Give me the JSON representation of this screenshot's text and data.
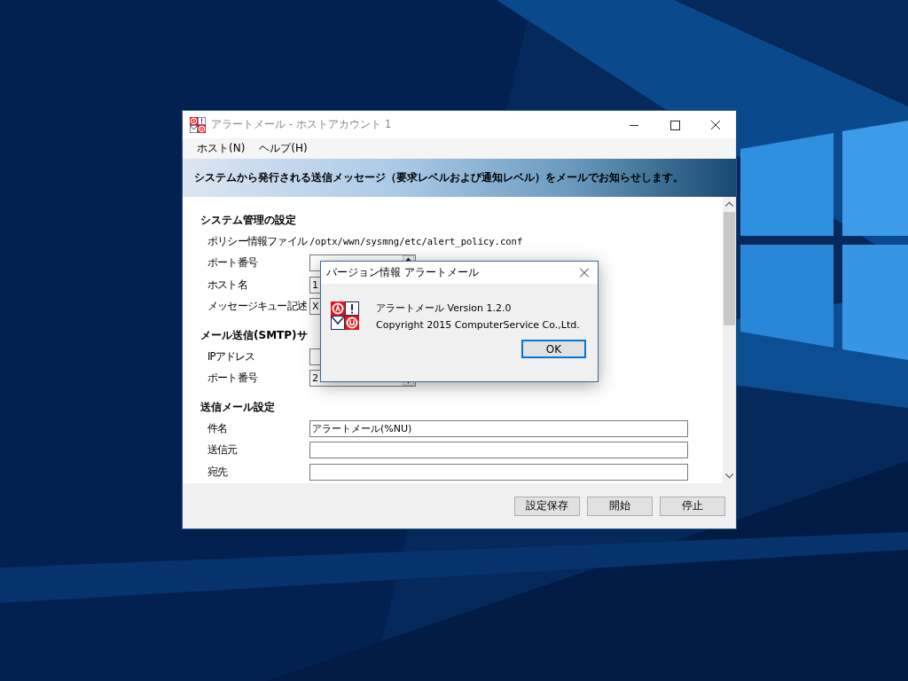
{
  "window": {
    "title": "アラートメール - ホストアカウント 1",
    "menu": [
      {
        "label": "ホスト(N)"
      },
      {
        "label": "ヘルプ(H)"
      }
    ],
    "banner": "システムから発行される送信メッセージ（要求レベルおよび通知レベル）をメールでお知らせします。",
    "sections": [
      {
        "heading": "システム管理の設定",
        "rows": [
          {
            "label": "ポリシー情報ファイル",
            "kind": "text",
            "value": "/optx/wwn/sysmng/etc/alert_policy.conf"
          },
          {
            "label": "ポート番号",
            "kind": "spin",
            "value": ""
          },
          {
            "label": "ホスト名",
            "kind": "field",
            "value": "1"
          },
          {
            "label": "メッセージキュー記述",
            "kind": "field",
            "value": "X"
          }
        ]
      },
      {
        "heading": "メール送信(SMTP)サ",
        "rows": [
          {
            "label": "IPアドレス",
            "kind": "field",
            "value": ""
          },
          {
            "label": "ポート番号",
            "kind": "spin",
            "value": "2"
          }
        ]
      },
      {
        "heading": "送信メール設定",
        "rows": [
          {
            "label": "件名",
            "kind": "wide",
            "value": "アラートメール(%NU)"
          },
          {
            "label": "送信元",
            "kind": "wide",
            "value": ""
          },
          {
            "label": "宛先",
            "kind": "wide",
            "value": ""
          }
        ]
      }
    ],
    "buttons": [
      "設定保存",
      "開始",
      "停止"
    ]
  },
  "dialog": {
    "title": "バージョン情報 アラートメール",
    "lines": [
      "アラートメール Version 1.2.0",
      "Copyright 2015 ComputerService Co.,Ltd."
    ],
    "button": {
      "label": "OK",
      "focused": true
    }
  }
}
